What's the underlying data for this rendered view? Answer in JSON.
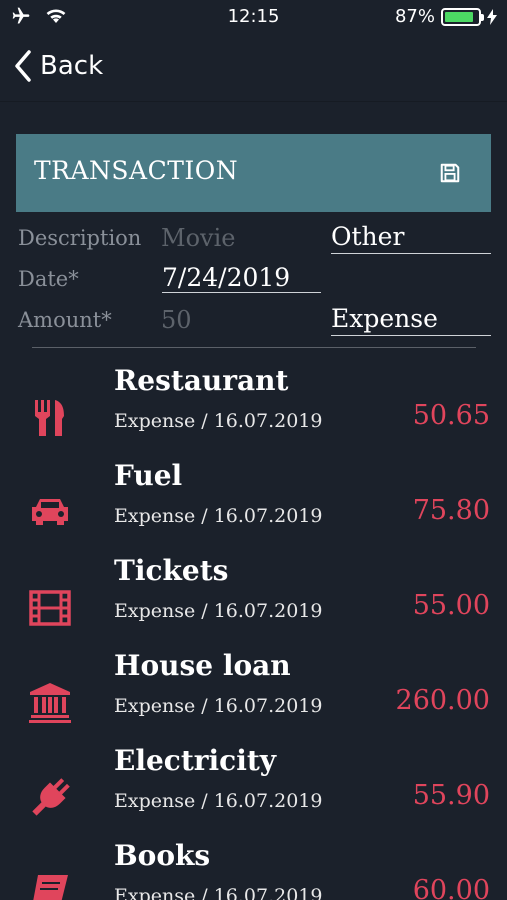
{
  "status_bar": {
    "time": "12:15",
    "battery_percent": "87%",
    "battery_level": 0.87
  },
  "nav": {
    "back_label": "Back"
  },
  "header": {
    "title": "TRANSACTION"
  },
  "form": {
    "description_label": "Description",
    "description_placeholder": "Movie",
    "category_value": "Other",
    "date_label": "Date*",
    "date_value": "7/24/2019",
    "amount_label": "Amount*",
    "amount_placeholder": "50",
    "type_value": "Expense"
  },
  "transactions": [
    {
      "name": "Restaurant",
      "type": "Expense",
      "date": "16.07.2019",
      "amount": "50.65",
      "icon": "restaurant-icon"
    },
    {
      "name": "Fuel",
      "type": "Expense",
      "date": "16.07.2019",
      "amount": "75.80",
      "icon": "car-icon"
    },
    {
      "name": "Tickets",
      "type": "Expense",
      "date": "16.07.2019",
      "amount": "55.00",
      "icon": "film-icon"
    },
    {
      "name": "House loan",
      "type": "Expense",
      "date": "16.07.2019",
      "amount": "260.00",
      "icon": "bank-icon"
    },
    {
      "name": "Electricity",
      "type": "Expense",
      "date": "16.07.2019",
      "amount": "55.90",
      "icon": "plug-icon"
    },
    {
      "name": "Books",
      "type": "Expense",
      "date": "16.07.2019",
      "amount": "60.00",
      "icon": "book-icon"
    }
  ],
  "colors": {
    "background": "#1b212b",
    "header": "#4a7b86",
    "accent": "#e0455c"
  }
}
